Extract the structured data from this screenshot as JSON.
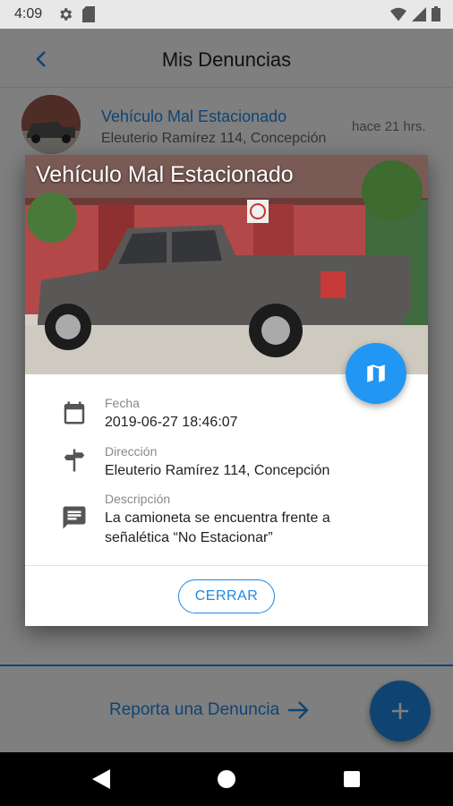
{
  "status_bar": {
    "time": "4:09",
    "icons": [
      "gear-icon",
      "sd-card-icon",
      "wifi-icon",
      "signal-icon",
      "battery-icon"
    ]
  },
  "app_bar": {
    "title": "Mis Denuncias",
    "back_icon": "chevron-left-icon"
  },
  "list": {
    "items": [
      {
        "title": "Vehículo Mal Estacionado",
        "subtitle": "Eleuterio Ramírez 114, Concepción",
        "time": "hace 21 hrs."
      }
    ]
  },
  "bottom": {
    "report_label": "Reporta una Denuncia",
    "add_icon": "plus-icon"
  },
  "dialog": {
    "title": "Vehículo Mal Estacionado",
    "map_icon": "map-icon",
    "fields": [
      {
        "label": "Fecha",
        "value": "2019-06-27 18:46:07",
        "icon": "calendar-icon"
      },
      {
        "label": "Dirección",
        "value": "Eleuterio Ramírez 114, Concepción",
        "icon": "signpost-icon"
      },
      {
        "label": "Descripción",
        "value": "La camioneta se encuentra frente a señalética “No Estacionar”",
        "icon": "comment-icon"
      }
    ],
    "close_label": "CERRAR"
  },
  "colors": {
    "accent": "#1e88e5",
    "fab": "#2196f3"
  }
}
